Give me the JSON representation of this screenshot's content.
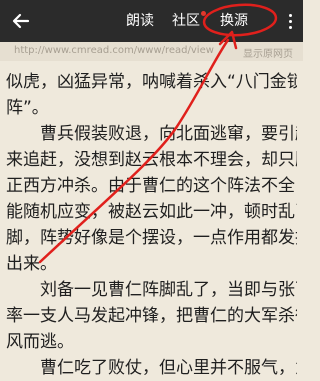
{
  "topbar": {
    "read_aloud": "朗读",
    "community": "社区",
    "change_source": "换源",
    "back_icon": "back-arrow-icon",
    "more_icon": "more-vertical-icon"
  },
  "urlbar": {
    "url": "http://www.cmread.com/www/read/view",
    "source_label": "显示原网页"
  },
  "content": {
    "lines": [
      "似虎，凶猛异常，呐喊着杀入“八门金锁",
      "阵”。",
      "曹兵假装败退，向北面逃窜，要引赵云",
      "来追赶，没想到赵云根本不理会，却只顾往",
      "正西方冲杀。由于曹仁的这个阵法不全，不",
      "能随机应变，被赵云如此一冲，顿时乱了阵",
      "脚，阵势好像是个摆设，一点作用都发挥不",
      "出来。",
      "刘备一见曹仁阵脚乱了，当即与张飞各",
      "率一支人马发起冲锋，把曹仁的大军杀得望",
      "风而逃。",
      "曹仁吃了败仗，但心里并不服气，为删"
    ]
  },
  "colors": {
    "topbar_bg": "#2b2b2b",
    "page_bg": "#efe9dc",
    "annotation_red": "#e0201c",
    "notify_dot": "#e2382c"
  }
}
